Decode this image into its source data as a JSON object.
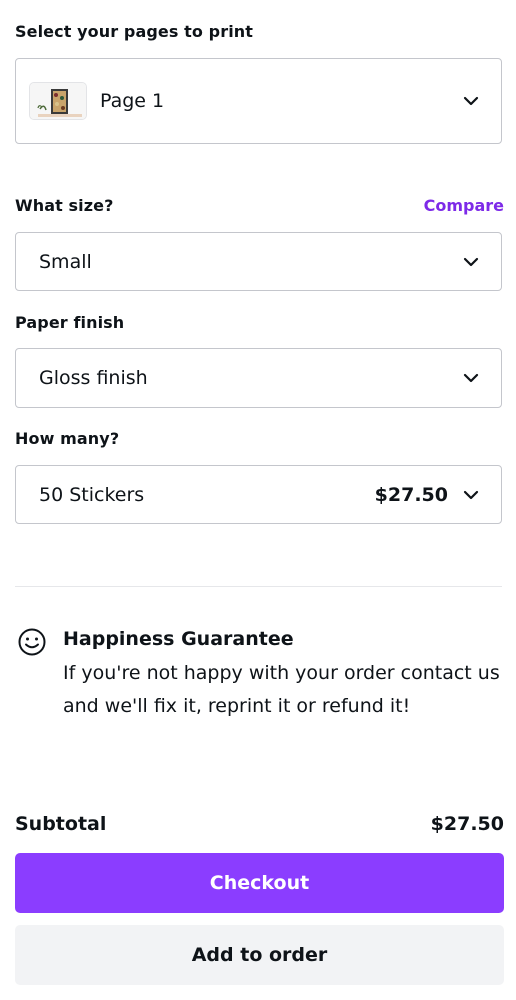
{
  "pages": {
    "label": "Select your pages to print",
    "selected": "Page 1"
  },
  "size": {
    "label": "What size?",
    "compare_label": "Compare",
    "selected": "Small"
  },
  "finish": {
    "label": "Paper finish",
    "selected": "Gloss finish"
  },
  "quantity": {
    "label": "How many?",
    "selected": "50 Stickers",
    "price": "$27.50"
  },
  "guarantee": {
    "icon": "smiley-icon",
    "title": "Happiness Guarantee",
    "text": "If you're not happy with your order contact us and we'll fix it, reprint it or refund it!"
  },
  "summary": {
    "subtotal_label": "Subtotal",
    "subtotal_value": "$27.50"
  },
  "actions": {
    "checkout_label": "Checkout",
    "add_label": "Add to order"
  },
  "colors": {
    "accent": "#8b3dff",
    "link": "#7d2ae8",
    "secondary_button": "#f2f3f5",
    "border": "#c4c6cc"
  }
}
